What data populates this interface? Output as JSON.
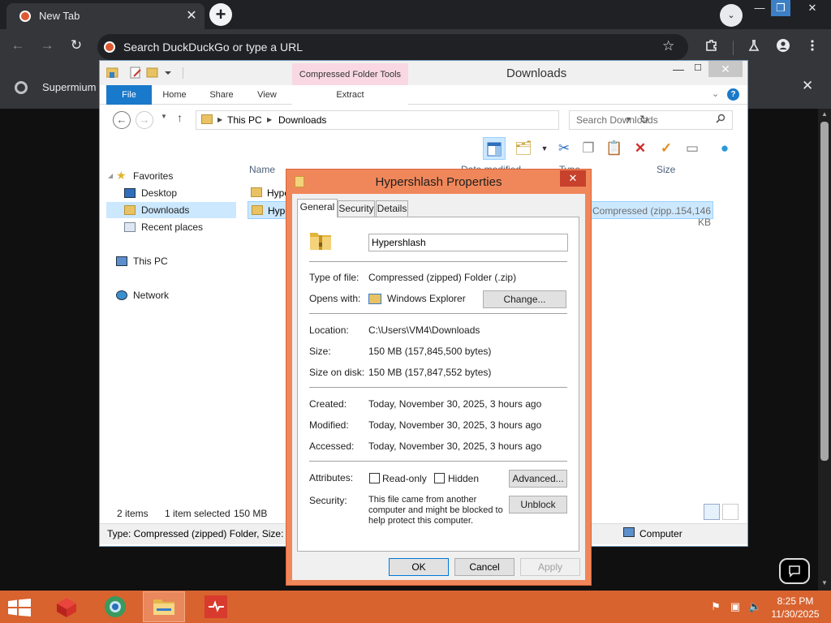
{
  "browser": {
    "tab_title": "New Tab",
    "tab_close": "✕",
    "new_tab": "+",
    "tab_search": "⌄",
    "win_min": "—",
    "win_max": "❐",
    "win_close": "✕",
    "back": "←",
    "forward": "→",
    "reload": "↻",
    "omnibox_placeholder": "Search DuckDuckGo or type a URL",
    "bookmark": "☆",
    "notification_text": "Supermium",
    "notification_close": "✕"
  },
  "explorer": {
    "title": "Downloads",
    "contextual_tab_group": "Compressed Folder Tools",
    "ribbon_tabs": [
      "File",
      "Home",
      "Share",
      "View"
    ],
    "contextual_tab": "Extract",
    "breadcrumb": [
      "This PC",
      "Downloads"
    ],
    "search_placeholder": "Search Downloads",
    "nav": {
      "favorites": "Favorites",
      "desktop": "Desktop",
      "downloads": "Downloads",
      "recent": "Recent places",
      "this_pc": "This PC",
      "network": "Network"
    },
    "columns": {
      "name": "Name",
      "date": "Date modified",
      "type": "Type",
      "size": "Size"
    },
    "files": [
      {
        "name": "Hypershlash",
        "type": "",
        "size": ""
      },
      {
        "name": "Hypershlash",
        "type": "Compressed (zipp...",
        "size": "154,146 KB"
      }
    ],
    "status": {
      "items": "2 items",
      "selected": "1 item selected",
      "selected_size": "150 MB"
    },
    "details": "Type: Compressed (zipped) Folder, Size: 150 MB",
    "details_location": "Computer"
  },
  "dialog": {
    "title": "Hypershlash Properties",
    "tabs": [
      "General",
      "Security",
      "Details"
    ],
    "name": "Hypershlash",
    "type_label": "Type of file:",
    "type_value": "Compressed (zipped) Folder (.zip)",
    "opens_label": "Opens with:",
    "opens_value": "Windows Explorer",
    "change_button": "Change...",
    "location_label": "Location:",
    "location_value": "C:\\Users\\VM4\\Downloads",
    "size_label": "Size:",
    "size_value": "150 MB (157,845,500 bytes)",
    "size_on_disk_label": "Size on disk:",
    "size_on_disk_value": "150 MB (157,847,552 bytes)",
    "created_label": "Created:",
    "created_value": "Today, November 30, 2025, 3 hours ago",
    "modified_label": "Modified:",
    "modified_value": "Today, November 30, 2025, 3 hours ago",
    "accessed_label": "Accessed:",
    "accessed_value": "Today, November 30, 2025, 3 hours ago",
    "attributes_label": "Attributes:",
    "readonly_label": "Read-only",
    "hidden_label": "Hidden",
    "advanced_button": "Advanced...",
    "security_label": "Security:",
    "security_line1": "This file came from another",
    "security_line2": "computer and might be blocked to",
    "security_line3": "help protect this computer.",
    "unblock_button": "Unblock",
    "ok": "OK",
    "cancel": "Cancel",
    "apply": "Apply"
  },
  "taskbar": {
    "time": "8:25 PM",
    "date": "11/30/2025"
  },
  "colors": {
    "taskbar": "#d8632f",
    "dialog_frame": "#f0875a",
    "ribbon_file": "#1979ca",
    "selection": "#cce8ff"
  }
}
